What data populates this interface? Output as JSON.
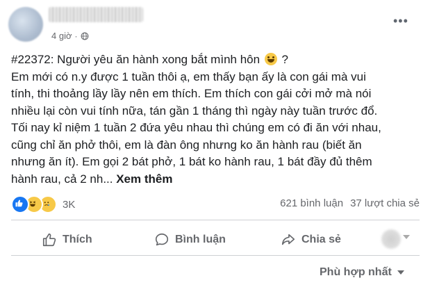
{
  "post": {
    "time": "4 giờ",
    "separator": "·",
    "title_line_prefix": "#22372: Người yêu ăn hành xong bắt mình hôn",
    "title_line_suffix": " ?",
    "body_lines": [
      "Em mới có n.y được 1 tuần thôi ạ, em thấy bạn ấy là con gái mà vui",
      "tính, thi thoảng lầy lầy nên em thích. Em thích con gái cởi mở mà nói",
      "nhiều lại còn vui tính nữa, tán gần 1 tháng thì ngày này tuần trước đổ.",
      "Tối nay kỉ niệm 1 tuần 2 đứa yêu nhau thì chúng em có đi ăn với nhau,",
      "cũng chỉ ăn phở thôi, em là đàn ông nhưng ko ăn hành rau (biết ăn",
      "nhưng ăn ít). Em gọi 2 bát phở, 1 bát ko hành rau, 1 bát đầy đủ thêm"
    ],
    "last_line": "hành rau, cả 2 nh... ",
    "see_more": "Xem thêm"
  },
  "stats": {
    "reaction_count": "3K",
    "comments": "621 bình luận",
    "shares": "37 lượt chia sẻ"
  },
  "actions": {
    "like": "Thích",
    "comment": "Bình luận",
    "share": "Chia sẻ"
  },
  "sort": {
    "label": "Phù hợp nhất"
  },
  "colors": {
    "like_blue": "#1877f2",
    "emoji_yellow": "#f7c948",
    "secondary_text": "#65676b"
  }
}
